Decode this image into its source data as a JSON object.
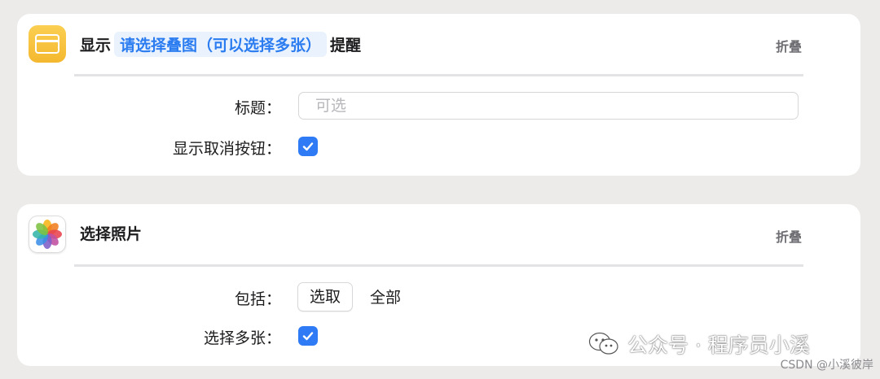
{
  "alert_action": {
    "icon": "alert-window-icon",
    "title_prefix": "显示",
    "variable_token": "请选择叠图（可以选择多张）",
    "title_suffix": "提醒",
    "collapse_label": "折叠",
    "rows": {
      "title_label": "标题：",
      "title_placeholder": "可选",
      "show_cancel_label": "显示取消按钮：",
      "show_cancel_checked": true
    }
  },
  "photos_action": {
    "icon": "photos-icon",
    "title": "选择照片",
    "collapse_label": "折叠",
    "rows": {
      "include_label": "包括：",
      "include_button": "选取",
      "include_value": "全部",
      "select_multiple_label": "选择多张：",
      "select_multiple_checked": true
    }
  },
  "watermark": {
    "text": "公众号 · 程序员小溪",
    "credit": "CSDN @小溪彼岸"
  },
  "colors": {
    "accent": "#2f7bf5",
    "token_text": "#2a7cf0",
    "alert_icon": "#f6bf38",
    "background": "#ecebe9"
  }
}
